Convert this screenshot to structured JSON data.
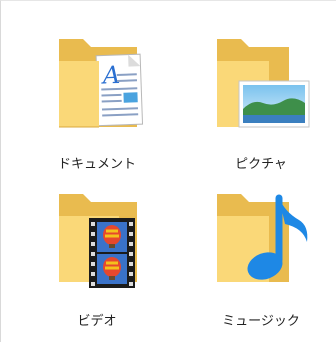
{
  "explorer": {
    "items": [
      {
        "label": "ドキュメント",
        "icon": "documents-folder-icon"
      },
      {
        "label": "ピクチャ",
        "icon": "pictures-folder-icon"
      },
      {
        "label": "ビデオ",
        "icon": "videos-folder-icon"
      },
      {
        "label": "ミュージック",
        "icon": "music-folder-icon"
      }
    ]
  },
  "colors": {
    "folder_back": "#e7b94a",
    "folder_front": "#fad878",
    "music_note": "#1e88e5"
  }
}
